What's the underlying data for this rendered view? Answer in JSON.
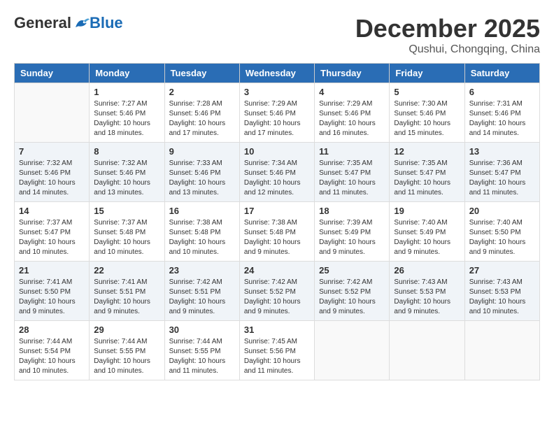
{
  "logo": {
    "general": "General",
    "blue": "Blue"
  },
  "title": "December 2025",
  "location": "Qushui, Chongqing, China",
  "days_of_week": [
    "Sunday",
    "Monday",
    "Tuesday",
    "Wednesday",
    "Thursday",
    "Friday",
    "Saturday"
  ],
  "weeks": [
    {
      "shaded": false,
      "days": [
        {
          "num": "",
          "info": ""
        },
        {
          "num": "1",
          "info": "Sunrise: 7:27 AM\nSunset: 5:46 PM\nDaylight: 10 hours\nand 18 minutes."
        },
        {
          "num": "2",
          "info": "Sunrise: 7:28 AM\nSunset: 5:46 PM\nDaylight: 10 hours\nand 17 minutes."
        },
        {
          "num": "3",
          "info": "Sunrise: 7:29 AM\nSunset: 5:46 PM\nDaylight: 10 hours\nand 17 minutes."
        },
        {
          "num": "4",
          "info": "Sunrise: 7:29 AM\nSunset: 5:46 PM\nDaylight: 10 hours\nand 16 minutes."
        },
        {
          "num": "5",
          "info": "Sunrise: 7:30 AM\nSunset: 5:46 PM\nDaylight: 10 hours\nand 15 minutes."
        },
        {
          "num": "6",
          "info": "Sunrise: 7:31 AM\nSunset: 5:46 PM\nDaylight: 10 hours\nand 14 minutes."
        }
      ]
    },
    {
      "shaded": true,
      "days": [
        {
          "num": "7",
          "info": "Sunrise: 7:32 AM\nSunset: 5:46 PM\nDaylight: 10 hours\nand 14 minutes."
        },
        {
          "num": "8",
          "info": "Sunrise: 7:32 AM\nSunset: 5:46 PM\nDaylight: 10 hours\nand 13 minutes."
        },
        {
          "num": "9",
          "info": "Sunrise: 7:33 AM\nSunset: 5:46 PM\nDaylight: 10 hours\nand 13 minutes."
        },
        {
          "num": "10",
          "info": "Sunrise: 7:34 AM\nSunset: 5:46 PM\nDaylight: 10 hours\nand 12 minutes."
        },
        {
          "num": "11",
          "info": "Sunrise: 7:35 AM\nSunset: 5:47 PM\nDaylight: 10 hours\nand 11 minutes."
        },
        {
          "num": "12",
          "info": "Sunrise: 7:35 AM\nSunset: 5:47 PM\nDaylight: 10 hours\nand 11 minutes."
        },
        {
          "num": "13",
          "info": "Sunrise: 7:36 AM\nSunset: 5:47 PM\nDaylight: 10 hours\nand 11 minutes."
        }
      ]
    },
    {
      "shaded": false,
      "days": [
        {
          "num": "14",
          "info": "Sunrise: 7:37 AM\nSunset: 5:47 PM\nDaylight: 10 hours\nand 10 minutes."
        },
        {
          "num": "15",
          "info": "Sunrise: 7:37 AM\nSunset: 5:48 PM\nDaylight: 10 hours\nand 10 minutes."
        },
        {
          "num": "16",
          "info": "Sunrise: 7:38 AM\nSunset: 5:48 PM\nDaylight: 10 hours\nand 10 minutes."
        },
        {
          "num": "17",
          "info": "Sunrise: 7:38 AM\nSunset: 5:48 PM\nDaylight: 10 hours\nand 9 minutes."
        },
        {
          "num": "18",
          "info": "Sunrise: 7:39 AM\nSunset: 5:49 PM\nDaylight: 10 hours\nand 9 minutes."
        },
        {
          "num": "19",
          "info": "Sunrise: 7:40 AM\nSunset: 5:49 PM\nDaylight: 10 hours\nand 9 minutes."
        },
        {
          "num": "20",
          "info": "Sunrise: 7:40 AM\nSunset: 5:50 PM\nDaylight: 10 hours\nand 9 minutes."
        }
      ]
    },
    {
      "shaded": true,
      "days": [
        {
          "num": "21",
          "info": "Sunrise: 7:41 AM\nSunset: 5:50 PM\nDaylight: 10 hours\nand 9 minutes."
        },
        {
          "num": "22",
          "info": "Sunrise: 7:41 AM\nSunset: 5:51 PM\nDaylight: 10 hours\nand 9 minutes."
        },
        {
          "num": "23",
          "info": "Sunrise: 7:42 AM\nSunset: 5:51 PM\nDaylight: 10 hours\nand 9 minutes."
        },
        {
          "num": "24",
          "info": "Sunrise: 7:42 AM\nSunset: 5:52 PM\nDaylight: 10 hours\nand 9 minutes."
        },
        {
          "num": "25",
          "info": "Sunrise: 7:42 AM\nSunset: 5:52 PM\nDaylight: 10 hours\nand 9 minutes."
        },
        {
          "num": "26",
          "info": "Sunrise: 7:43 AM\nSunset: 5:53 PM\nDaylight: 10 hours\nand 9 minutes."
        },
        {
          "num": "27",
          "info": "Sunrise: 7:43 AM\nSunset: 5:53 PM\nDaylight: 10 hours\nand 10 minutes."
        }
      ]
    },
    {
      "shaded": false,
      "days": [
        {
          "num": "28",
          "info": "Sunrise: 7:44 AM\nSunset: 5:54 PM\nDaylight: 10 hours\nand 10 minutes."
        },
        {
          "num": "29",
          "info": "Sunrise: 7:44 AM\nSunset: 5:55 PM\nDaylight: 10 hours\nand 10 minutes."
        },
        {
          "num": "30",
          "info": "Sunrise: 7:44 AM\nSunset: 5:55 PM\nDaylight: 10 hours\nand 11 minutes."
        },
        {
          "num": "31",
          "info": "Sunrise: 7:45 AM\nSunset: 5:56 PM\nDaylight: 10 hours\nand 11 minutes."
        },
        {
          "num": "",
          "info": ""
        },
        {
          "num": "",
          "info": ""
        },
        {
          "num": "",
          "info": ""
        }
      ]
    }
  ]
}
